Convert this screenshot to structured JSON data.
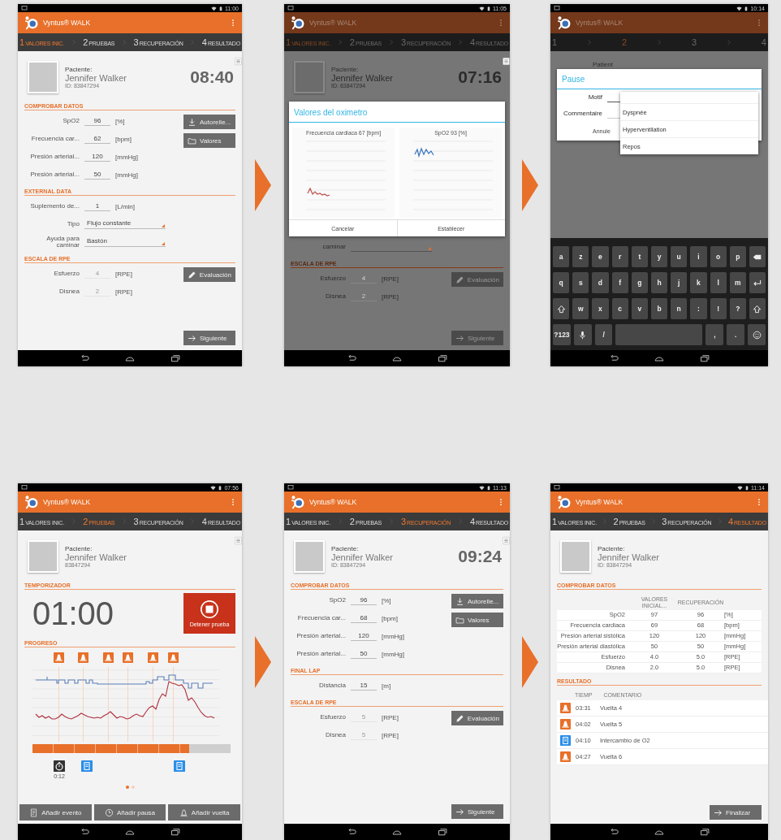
{
  "screens": [
    {
      "kind": "form",
      "status_time": "11:00",
      "dimmed": false,
      "app_title": "Vyntus® WALK",
      "steps": [
        {
          "number": "1",
          "label": "VALORES INIC.",
          "selected": true
        },
        {
          "number": "2",
          "label": "PRUEBAS",
          "selected": false
        },
        {
          "number": "3",
          "label": "RECUPERACIÓN",
          "selected": false
        },
        {
          "number": "4",
          "label": "RESULTADO",
          "selected": false
        }
      ],
      "patient": {
        "label": "Paciente:",
        "name": "Jennifer Walker",
        "id": "ID: 83847294"
      },
      "clock": "08:40",
      "sections": [
        {
          "title": "COMPROBAR DATOS",
          "rows": [
            {
              "kind": "field",
              "label": "SpO2",
              "value": "96",
              "unit": "[%]",
              "disabled": false
            },
            {
              "kind": "field",
              "label": "Frecuencia car...",
              "value": "62",
              "unit": "[bpm]",
              "disabled": false
            },
            {
              "kind": "field",
              "label": "Presión arterial...",
              "value": "120",
              "unit": "[mmHg]",
              "disabled": false
            },
            {
              "kind": "field",
              "label": "Presión arterial...",
              "value": "50",
              "unit": "[mmHg]",
              "disabled": false
            }
          ],
          "buttons": [
            {
              "kind": "download",
              "label": "Autorelle..."
            },
            {
              "kind": "folder",
              "label": "Valores"
            }
          ]
        },
        {
          "title": "EXTERNAL DATA",
          "rows": [
            {
              "kind": "field",
              "label": "Suplemento de...",
              "value": "1",
              "unit": "[L/min]",
              "disabled": false
            },
            {
              "kind": "select",
              "label": "Tipo",
              "value": "Flujo constante",
              "disabled": false
            },
            {
              "kind": "select",
              "label": "Ayuda para caminar",
              "value": "Bastón",
              "disabled": false
            }
          ]
        },
        {
          "title": "ESCALA DE RPE",
          "rows": [
            {
              "kind": "field",
              "label": "Esfuerzo",
              "value": "4",
              "unit": "[RPE]",
              "disabled": true
            },
            {
              "kind": "field",
              "label": "Disnea",
              "value": "2",
              "unit": "[RPE]",
              "disabled": true
            }
          ],
          "buttons": [
            {
              "kind": "pencil",
              "label": "Evaluación"
            }
          ]
        }
      ],
      "next_button": {
        "kind": "next",
        "label": "Siguiente"
      }
    },
    {
      "kind": "form",
      "status_time": "11:05",
      "dimmed": true,
      "app_title": "Vyntus® WALK",
      "steps": [
        {
          "number": "1",
          "label": "VALORES INIC.",
          "selected": true
        },
        {
          "number": "2",
          "label": "PRUEBAS",
          "selected": false
        },
        {
          "number": "3",
          "label": "RECUPERACIÓN",
          "selected": false
        },
        {
          "number": "4",
          "label": "RESULTADO",
          "selected": false
        }
      ],
      "patient": {
        "label": "Paciente:",
        "name": "Jennifer Walker",
        "id": "ID: 83847294"
      },
      "clock": "07:16",
      "dialog": {
        "title": "Valores del oximetro",
        "charts": [
          {
            "title": "Frecuencia cardiaca 67 [bpm]",
            "color": "#c0504d"
          },
          {
            "title": "SpO2 93 [%]",
            "color": "#3a78c2"
          }
        ],
        "buttons": [
          "Cancelar",
          "Establecer"
        ]
      },
      "sections": [
        {
          "rows": [
            {
              "kind": "select",
              "label": "caminar",
              "disabled": false
            }
          ]
        },
        {
          "title": "ESCALA DE RPE",
          "rows": [
            {
              "kind": "field",
              "label": "Esfuerzo",
              "value": "4",
              "unit": "[RPE]",
              "disabled": true
            },
            {
              "kind": "field",
              "label": "Disnea",
              "value": "2",
              "unit": "[RPE]",
              "disabled": true
            }
          ],
          "buttons": [
            {
              "kind": "pencil",
              "label": "Evaluación"
            }
          ]
        }
      ],
      "next_button": {
        "kind": "next",
        "label": "Siguiente"
      }
    },
    {
      "kind": "pause_dialog",
      "status_time": "10:14",
      "dimmed": true,
      "app_title": "Vyntus® WALK",
      "steps": [
        {
          "number": "1",
          "selected": false
        },
        {
          "number": "2",
          "selected": true
        },
        {
          "number": "3",
          "selected": false
        },
        {
          "number": "4",
          "selected": false
        }
      ],
      "patient": {
        "label": "Patient"
      },
      "dialog": {
        "title": "Pause",
        "fields": [
          {
            "kind": "select",
            "label": "Motif"
          },
          {
            "kind": "text",
            "label": "Commentaire"
          }
        ],
        "buttons": [
          "Annule"
        ]
      },
      "dropdown": {
        "items": [
          {
            "label": "Dyspnée",
            "selected": false
          },
          {
            "label": "Hyperventilation",
            "selected": false
          },
          {
            "label": "Repos",
            "selected": false
          }
        ]
      },
      "keyboard": {
        "rows": [
          [
            {
              "kind": "char",
              "label": "a"
            },
            {
              "kind": "char",
              "label": "z"
            },
            {
              "kind": "char",
              "label": "e"
            },
            {
              "kind": "char",
              "label": "r"
            },
            {
              "kind": "char",
              "label": "t"
            },
            {
              "kind": "char",
              "label": "y"
            },
            {
              "kind": "char",
              "label": "u"
            },
            {
              "kind": "char",
              "label": "i"
            },
            {
              "kind": "char",
              "label": "o"
            },
            {
              "kind": "char",
              "label": "p"
            },
            {
              "kind": "backspace"
            }
          ],
          [
            {
              "kind": "char",
              "label": "q"
            },
            {
              "kind": "char",
              "label": "s"
            },
            {
              "kind": "char",
              "label": "d"
            },
            {
              "kind": "char",
              "label": "f"
            },
            {
              "kind": "char",
              "label": "g"
            },
            {
              "kind": "char",
              "label": "h"
            },
            {
              "kind": "char",
              "label": "j"
            },
            {
              "kind": "char",
              "label": "k"
            },
            {
              "kind": "char",
              "label": "l"
            },
            {
              "kind": "char",
              "label": "m"
            },
            {
              "kind": "enter"
            }
          ],
          [
            {
              "kind": "shift"
            },
            {
              "kind": "char",
              "label": "w"
            },
            {
              "kind": "char",
              "label": "x"
            },
            {
              "kind": "char",
              "label": "c"
            },
            {
              "kind": "char",
              "label": "v"
            },
            {
              "kind": "char",
              "label": "b"
            },
            {
              "kind": "char",
              "label": "n"
            },
            {
              "kind": "char",
              "label": ":"
            },
            {
              "kind": "char",
              "label": "!"
            },
            {
              "kind": "char",
              "label": "?"
            },
            {
              "kind": "shift"
            }
          ],
          [
            {
              "kind": "char",
              "label": "?123"
            },
            {
              "kind": "mic"
            },
            {
              "kind": "char",
              "label": "/"
            },
            {
              "kind": "space"
            },
            {
              "kind": "char",
              "label": ","
            },
            {
              "kind": "char",
              "label": "."
            },
            {
              "kind": "emoji"
            }
          ]
        ]
      }
    },
    {
      "kind": "test",
      "status_time": "07:56",
      "dimmed": false,
      "app_title": "Vyntus® WALK",
      "steps": [
        {
          "number": "1",
          "label": "VALORES INIC.",
          "selected": false
        },
        {
          "number": "2",
          "label": "PRUEBAS",
          "selected": true
        },
        {
          "number": "3",
          "label": "RECUPERACIÓN",
          "selected": false
        },
        {
          "number": "4",
          "label": "RESULTADO",
          "selected": false
        }
      ],
      "patient": {
        "label": "Paciente:",
        "name": "Jennifer Walker",
        "id": "83847294"
      },
      "timer_section": "TEMPORIZADOR",
      "timer": "01:00",
      "stop_button": "Detener prueba",
      "progress_section": "PROGRESO",
      "progress": {
        "level": 0.79
      },
      "events": [
        {
          "kind": "stopwatch",
          "label": "0:12"
        },
        {
          "kind": "note"
        },
        {
          "kind": "note"
        }
      ],
      "pages": [
        {
          "selected": true
        },
        {
          "selected": false
        }
      ],
      "actions": [
        {
          "kind": "event",
          "label": "Añadir evento"
        },
        {
          "kind": "pause",
          "label": "Añadir pausa"
        },
        {
          "kind": "lap",
          "label": "Añadir vuelta"
        }
      ]
    },
    {
      "kind": "form",
      "status_time": "11:13",
      "dimmed": false,
      "app_title": "Vyntus® WALK",
      "steps": [
        {
          "number": "1",
          "label": "VALORES INIC.",
          "selected": false
        },
        {
          "number": "2",
          "label": "PRUEBAS",
          "selected": false
        },
        {
          "number": "3",
          "label": "RECUPERACIÓN",
          "selected": true
        },
        {
          "number": "4",
          "label": "RESULTADO",
          "selected": false
        }
      ],
      "patient": {
        "label": "Paciente:",
        "name": "Jennifer Walker",
        "id": "ID: 83847294"
      },
      "clock": "09:24",
      "sections": [
        {
          "title": "COMPROBAR DATOS",
          "rows": [
            {
              "kind": "field",
              "label": "SpO2",
              "value": "96",
              "unit": "[%]",
              "disabled": false
            },
            {
              "kind": "field",
              "label": "Frecuencia car...",
              "value": "68",
              "unit": "[bpm]",
              "disabled": false
            },
            {
              "kind": "field",
              "label": "Presión arterial...",
              "value": "120",
              "unit": "[mmHg]",
              "disabled": false
            },
            {
              "kind": "field",
              "label": "Presión arterial...",
              "value": "50",
              "unit": "[mmHg]",
              "disabled": false
            }
          ],
          "buttons": [
            {
              "kind": "download",
              "label": "Autorelle..."
            },
            {
              "kind": "folder",
              "label": "Valores"
            }
          ]
        },
        {
          "title": "FINAL LAP",
          "rows": [
            {
              "kind": "field",
              "label": "Distancia",
              "value": "15",
              "unit": "[m]",
              "disabled": false
            }
          ]
        },
        {
          "title": "ESCALA DE RPE",
          "rows": [
            {
              "kind": "field",
              "label": "Esfuerzo",
              "value": "5",
              "unit": "[RPE]",
              "disabled": true
            },
            {
              "kind": "field",
              "label": "Disnea",
              "value": "5",
              "unit": "[RPE]",
              "disabled": true
            }
          ],
          "buttons": [
            {
              "kind": "pencil",
              "label": "Evaluación"
            }
          ]
        }
      ],
      "next_button": {
        "kind": "next",
        "label": "Siguiente"
      }
    },
    {
      "kind": "results",
      "status_time": "11:14",
      "dimmed": false,
      "app_title": "Vyntus® WALK",
      "steps": [
        {
          "number": "1",
          "label": "VALORES INIC.",
          "selected": false
        },
        {
          "number": "2",
          "label": "PRUEBAS",
          "selected": false
        },
        {
          "number": "3",
          "label": "RECUPERACIÓN",
          "selected": false
        },
        {
          "number": "4",
          "label": "RESULTADO",
          "selected": true
        }
      ],
      "patient": {
        "label": "Paciente:",
        "name": "Jennifer Walker",
        "id": "ID: 83847294"
      },
      "check_section": "COMPROBAR DATOS",
      "table": {
        "columns": [
          "VALORES INICIAL...",
          "RECUPERACIÓN"
        ],
        "rows": [
          {
            "label": "SpO2",
            "initial": "97",
            "recovery": "96",
            "unit": "[%]"
          },
          {
            "label": "Frecuencia cardiaca",
            "initial": "69",
            "recovery": "68",
            "unit": "[bpm]"
          },
          {
            "label": "Presión arterial sistólica",
            "initial": "120",
            "recovery": "120",
            "unit": "[mmHg]"
          },
          {
            "label": "Presión arterial diastólica",
            "initial": "50",
            "recovery": "50",
            "unit": "[mmHg]"
          },
          {
            "label": "Esfuerzo",
            "initial": "4.0",
            "recovery": "5.0",
            "unit": "[RPE]"
          },
          {
            "label": "Disnea",
            "initial": "2.0",
            "recovery": "5.0",
            "unit": "[RPE]"
          }
        ]
      },
      "result_section": "RESULTADO",
      "log": {
        "columns": [
          "TIEMP",
          "COMENTARIO"
        ],
        "rows": [
          {
            "kind": "lap",
            "time": "03:31",
            "comment": "Vuelta 4"
          },
          {
            "kind": "lap",
            "time": "04:02",
            "comment": "Vuelta 5"
          },
          {
            "kind": "note",
            "time": "04:10",
            "comment": "Intercambio de O2"
          },
          {
            "kind": "lap",
            "time": "04:27",
            "comment": "Vuelta 6"
          }
        ]
      },
      "finish_button": {
        "kind": "next",
        "label": "Finalizar"
      }
    }
  ]
}
